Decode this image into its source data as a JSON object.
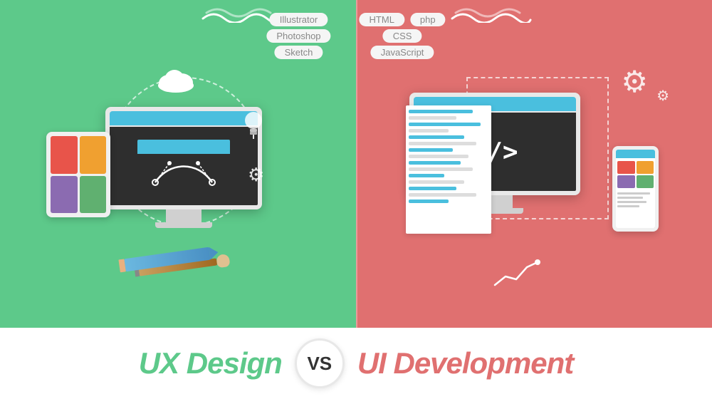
{
  "background": {
    "left_color": "#5DC98A",
    "right_color": "#E07070"
  },
  "skills": {
    "left": [
      "Illustrator",
      "Photoshop",
      "Sketch"
    ],
    "right": [
      "HTML",
      "php",
      "CSS",
      "JavaScript"
    ]
  },
  "tablet_colors": [
    "#E8544A",
    "#F0A030",
    "#8B6BB1",
    "#60B070"
  ],
  "phone_colors": [
    "#E8544A",
    "#F0A030",
    "#8B6BB1",
    "#60B070"
  ],
  "code_lines": [
    {
      "width": "80%",
      "color": "#4ABFDE"
    },
    {
      "width": "60%",
      "color": "#ccc"
    },
    {
      "width": "90%",
      "color": "#4ABFDE"
    },
    {
      "width": "50%",
      "color": "#ccc"
    },
    {
      "width": "70%",
      "color": "#4ABFDE"
    },
    {
      "width": "85%",
      "color": "#ccc"
    },
    {
      "width": "55%",
      "color": "#4ABFDE"
    },
    {
      "width": "75%",
      "color": "#ccc"
    },
    {
      "width": "65%",
      "color": "#4ABFDE"
    },
    {
      "width": "80%",
      "color": "#ccc"
    },
    {
      "width": "45%",
      "color": "#4ABFDE"
    },
    {
      "width": "70%",
      "color": "#ccc"
    },
    {
      "width": "60%",
      "color": "#4ABFDE"
    },
    {
      "width": "85%",
      "color": "#ccc"
    },
    {
      "width": "50%",
      "color": "#4ABFDE"
    }
  ],
  "title": {
    "left": "UX Design",
    "vs": "VS",
    "right": "UI Development"
  },
  "icons": {
    "cloud": "☁",
    "lightbulb": "💡",
    "gear": "⚙"
  }
}
